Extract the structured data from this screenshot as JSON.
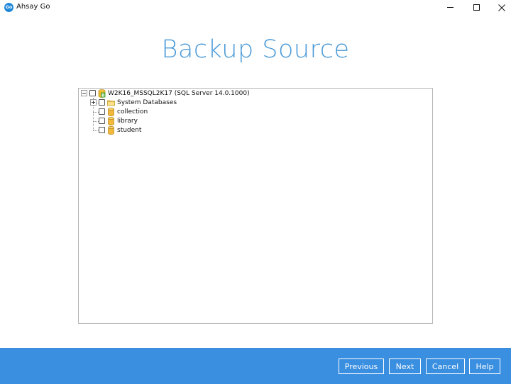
{
  "window": {
    "app_icon_text": "Go",
    "title": "Ahsay Go"
  },
  "page": {
    "heading": "Backup Source"
  },
  "tree": {
    "root": {
      "label": "W2K16_MSSQL2K17 (SQL Server 14.0.1000)",
      "icon": "sql-server-icon",
      "checked": false,
      "expanded": true
    },
    "children": [
      {
        "label": "System Databases",
        "icon": "folder-icon",
        "checked": false,
        "expandable": true,
        "expanded": false
      },
      {
        "label": "collection",
        "icon": "database-icon",
        "checked": false,
        "expandable": false
      },
      {
        "label": "library",
        "icon": "database-icon",
        "checked": false,
        "expandable": false
      },
      {
        "label": "student",
        "icon": "database-icon",
        "checked": false,
        "expandable": false
      }
    ]
  },
  "footer": {
    "previous_label": "Previous",
    "next_label": "Next",
    "cancel_label": "Cancel",
    "help_label": "Help"
  },
  "colors": {
    "accent": "#3a8fe0",
    "heading": "#4a9ad8"
  }
}
